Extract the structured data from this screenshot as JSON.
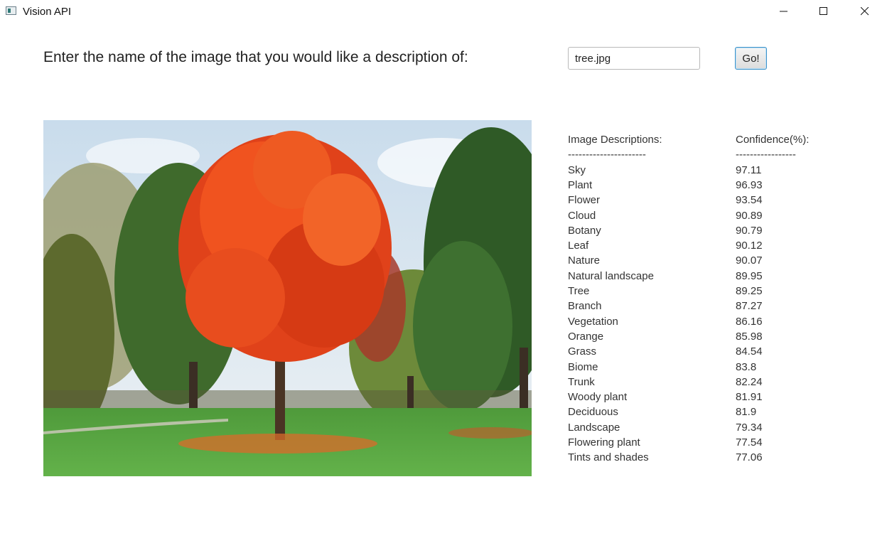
{
  "window": {
    "title": "Vision API",
    "icon": "app-window-icon"
  },
  "form": {
    "prompt": "Enter the name of the image that you would like a description of:",
    "filename_value": "tree.jpg",
    "go_label": "Go!"
  },
  "image": {
    "subject": "tree.jpg"
  },
  "results": {
    "description_header": "Image Descriptions:",
    "confidence_header": "Confidence(%):",
    "description_divider": "----------------------",
    "confidence_divider": "-----------------",
    "rows": [
      {
        "label": "Sky",
        "value": "97.11"
      },
      {
        "label": "Plant",
        "value": "96.93"
      },
      {
        "label": "Flower",
        "value": "93.54"
      },
      {
        "label": "Cloud",
        "value": "90.89"
      },
      {
        "label": "Botany",
        "value": "90.79"
      },
      {
        "label": "Leaf",
        "value": "90.12"
      },
      {
        "label": "Nature",
        "value": "90.07"
      },
      {
        "label": "Natural landscape",
        "value": "89.95"
      },
      {
        "label": "Tree",
        "value": "89.25"
      },
      {
        "label": "Branch",
        "value": "87.27"
      },
      {
        "label": "Vegetation",
        "value": "86.16"
      },
      {
        "label": "Orange",
        "value": "85.98"
      },
      {
        "label": "Grass",
        "value": "84.54"
      },
      {
        "label": "Biome",
        "value": "83.8"
      },
      {
        "label": "Trunk",
        "value": "82.24"
      },
      {
        "label": "Woody plant",
        "value": "81.91"
      },
      {
        "label": "Deciduous",
        "value": "81.9"
      },
      {
        "label": "Landscape",
        "value": "79.34"
      },
      {
        "label": "Flowering plant",
        "value": "77.54"
      },
      {
        "label": "Tints and shades",
        "value": "77.06"
      }
    ]
  }
}
